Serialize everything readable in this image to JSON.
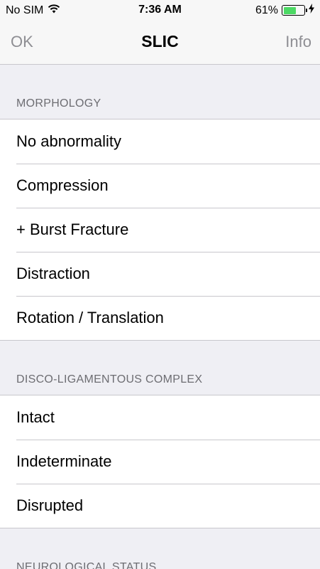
{
  "status_bar": {
    "carrier": "No SIM",
    "time": "7:36 AM",
    "battery_text": "61%",
    "battery_level": 0.61,
    "battery_color": "#4cd964",
    "wifi_icon": "wifi-icon",
    "charging_icon": "bolt-icon"
  },
  "nav": {
    "left_label": "OK",
    "title": "SLIC",
    "right_label": "Info"
  },
  "sections": [
    {
      "header": "MORPHOLOGY",
      "items": [
        "No abnormality",
        "Compression",
        "+ Burst Fracture",
        "Distraction",
        "Rotation / Translation"
      ]
    },
    {
      "header": "DISCO-LIGAMENTOUS COMPLEX",
      "items": [
        "Intact",
        "Indeterminate",
        "Disrupted"
      ]
    },
    {
      "header": "NEUROLOGICAL STATUS",
      "items": []
    }
  ]
}
